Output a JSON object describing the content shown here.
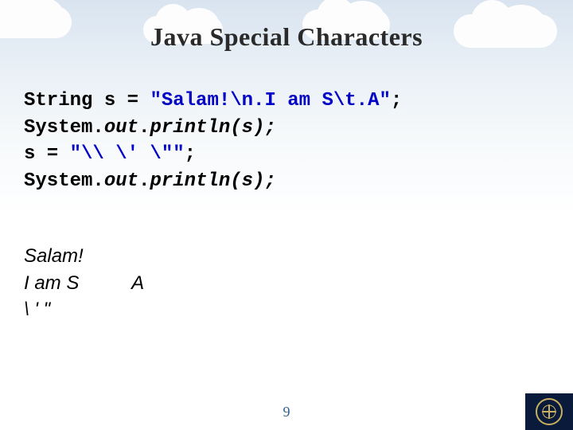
{
  "title": "Java Special Characters",
  "code": {
    "line1_pre": "String s = ",
    "line1_str": "\"Salam!\\n.I am S\\t.A\"",
    "line1_post": ";",
    "line2_pre": "System.",
    "line2_out": "out",
    "line2_post": ".",
    "line2_call": "println(s);",
    "line3_pre": "s = ",
    "line3_str": "\"\\\\ \\' \\\"\"",
    "line3_post": ";",
    "line4_pre": "System.",
    "line4_out": "out",
    "line4_post": ".",
    "line4_call": "println(s);"
  },
  "output": {
    "line1": "Salam!",
    "line2": "I am S          A",
    "line3": "\\ ' \""
  },
  "page_number": "9"
}
